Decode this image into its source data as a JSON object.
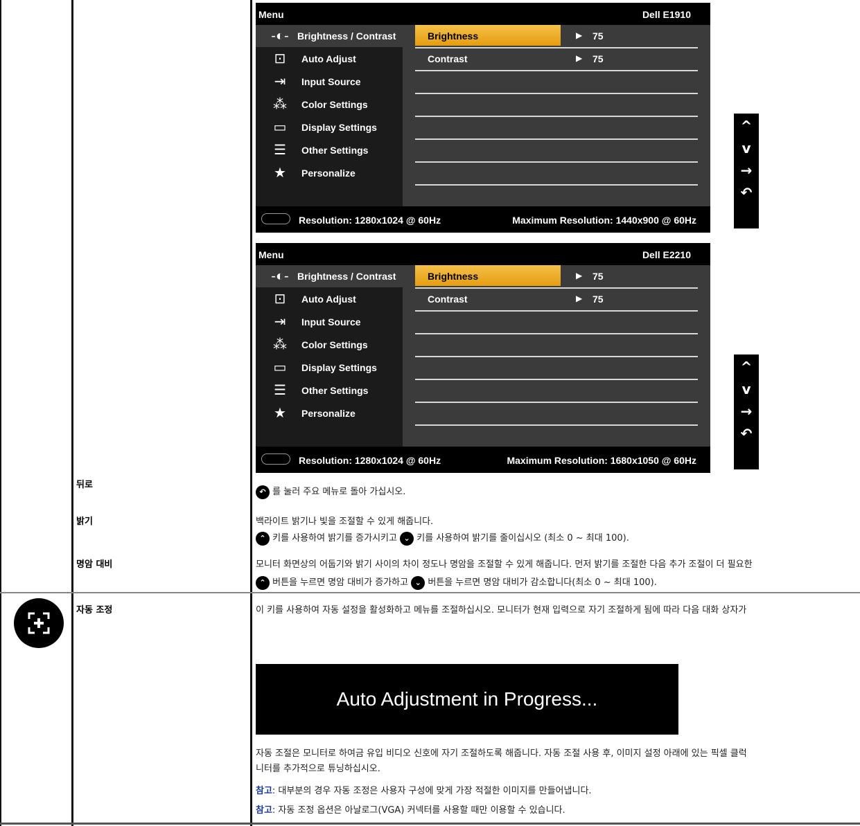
{
  "osd1": {
    "menu_title": "Menu",
    "model": "Dell  E1910",
    "items": [
      {
        "label": "Brightness / Contrast",
        "icon": "brightness-icon"
      },
      {
        "label": "Auto Adjust",
        "icon": "auto-adjust-icon"
      },
      {
        "label": "Input Source",
        "icon": "input-source-icon"
      },
      {
        "label": "Color Settings",
        "icon": "color-settings-icon"
      },
      {
        "label": "Display Settings",
        "icon": "display-settings-icon"
      },
      {
        "label": "Other Settings",
        "icon": "other-settings-icon"
      },
      {
        "label": "Personalize",
        "icon": "star-icon"
      }
    ],
    "sub": [
      {
        "label": "Brightness",
        "value": "75"
      },
      {
        "label": "Contrast",
        "value": "75"
      }
    ],
    "resolution": "Resolution: 1280x1024 @ 60Hz",
    "max_resolution": "Maximum Resolution: 1440x900 @ 60Hz"
  },
  "osd2": {
    "menu_title": "Menu",
    "model": "Dell  E2210",
    "items": [
      {
        "label": "Brightness / Contrast",
        "icon": "brightness-icon"
      },
      {
        "label": "Auto Adjust",
        "icon": "auto-adjust-icon"
      },
      {
        "label": "Input Source",
        "icon": "input-source-icon"
      },
      {
        "label": "Color Settings",
        "icon": "color-settings-icon"
      },
      {
        "label": "Display Settings",
        "icon": "display-settings-icon"
      },
      {
        "label": "Other Settings",
        "icon": "other-settings-icon"
      },
      {
        "label": "Personalize",
        "icon": "star-icon"
      }
    ],
    "sub": [
      {
        "label": "Brightness",
        "value": "75"
      },
      {
        "label": "Contrast",
        "value": "75"
      }
    ],
    "resolution": "Resolution: 1280x1024 @ 60Hz",
    "max_resolution": "Maximum Resolution: 1680x1050 @ 60Hz"
  },
  "keypad": {
    "up": "^",
    "down": "v",
    "enter": "→",
    "back": "↶"
  },
  "rows": {
    "back": {
      "label": "뒤로",
      "text": "를 눌러 주요 메뉴로 돌아 가십시오."
    },
    "brightness": {
      "label": "밝기",
      "line1": "백라이트 밝기나 빛을 조절할 수 있게 해줍니다.",
      "line2a": "키를 사용하여 밝기를 증가시키고",
      "line2b": "키를 사용하여 밝기를 줄이십시오 (최소 0 ~ 최대 100)."
    },
    "contrast": {
      "label": "명암 대비",
      "line1": "모니터 화면상의 어둡기와 밝기 사이의 차이 정도나 명암을 조절할 수 있게 해줍니다. 먼저 밝기를 조절한 다음 추가 조절이 더 필요한",
      "line2a": "버튼을 누르면 명암 대비가 증가하고",
      "line2b": "버튼을 누르면 명암 대비가 감소합니다(최소 0 ~ 최대 100)."
    },
    "auto": {
      "label": "자동 조정",
      "line1": "이 키를 사용하여 자동 설정을 활성화하고 메뉴를 조절하십시오. 모니터가 현재 입력으로 자기 조절하게 됨에 따라 다음 대화 상자가",
      "box": "Auto Adjustment in Progress...",
      "para1": "자동 조절은 모니터로 하여금 유입 비디오 신호에 자기 조절하도록 해줍니다. 자동 조절 사용 후, 이미지 설정 아래에 있는 픽셀 클럭",
      "para2": "니터를 추가적으로 튜닝하십시오.",
      "note_label": "참고",
      "note1": ": 대부분의 경우 자동 조정은 사용자 구성에 맞게 가장 적절한 이미지를 만들어냅니다.",
      "note2": ": 자동 조정 옵션은 아날로그(VGA) 커넥터를 사용할 때만 이용할 수 있습니다."
    }
  }
}
